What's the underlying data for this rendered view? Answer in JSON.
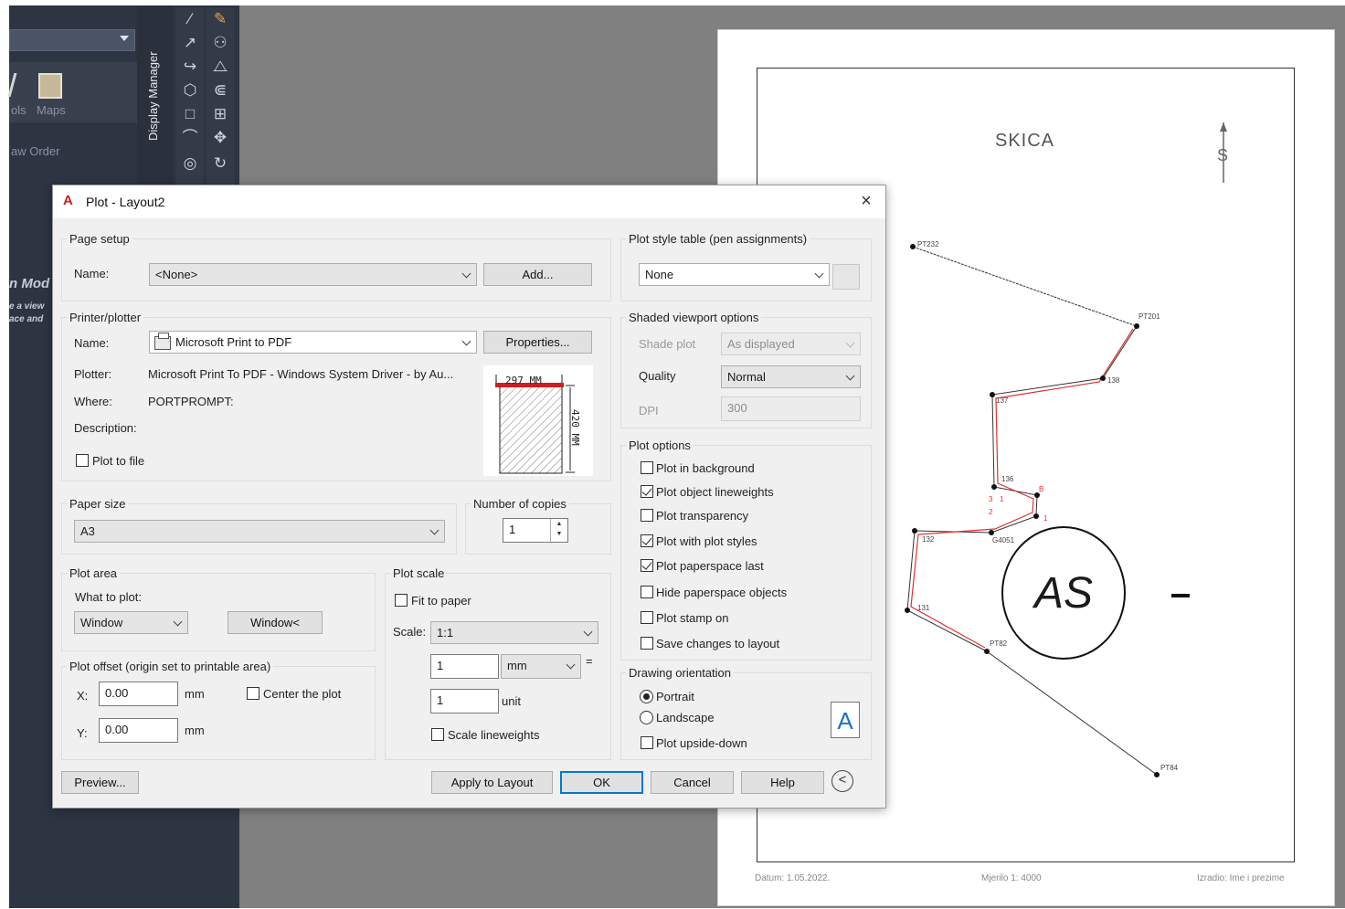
{
  "window": {
    "title": "Plot - Layout2",
    "close": "×"
  },
  "background": {
    "side_tools_label": "ols",
    "side_maps_label": "Maps",
    "side_draw_order": "aw Order",
    "display_manager": "Display Manager",
    "side_model": "n Mod",
    "side_view_1": "e a view",
    "side_view_2": "ace and"
  },
  "sheet": {
    "title": "SKICA",
    "north_symbol": "S",
    "footer_date": "Datum: 1.05.2022.",
    "footer_scale": "Mjerilo 1: 4000",
    "footer_author": "Izradio: Ime i prezime",
    "circle_text": "AS",
    "points": [
      "PT232",
      "PT201",
      "138",
      "137",
      "136",
      "B",
      "3",
      "1",
      "2",
      "132",
      "G4051",
      "131",
      "PT82",
      "PT84",
      "1"
    ]
  },
  "page_setup": {
    "label": "Page setup",
    "name_label": "Name:",
    "name_value": "<None>",
    "add_button": "Add..."
  },
  "printer": {
    "label": "Printer/plotter",
    "name_label": "Name:",
    "name_value": "Microsoft Print to PDF",
    "properties_button": "Properties...",
    "plotter_label": "Plotter:",
    "plotter_value": "Microsoft Print To PDF - Windows System Driver - by Au...",
    "where_label": "Where:",
    "where_value": "PORTPROMPT:",
    "description_label": "Description:",
    "plot_to_file": "Plot to file",
    "plot_to_file_checked": false,
    "preview_width": "297  MM",
    "preview_height": "420  MM"
  },
  "paper_size": {
    "label": "Paper size",
    "value": "A3"
  },
  "copies": {
    "label": "Number of copies",
    "value": "1"
  },
  "plot_area": {
    "label": "Plot area",
    "what_label": "What to plot:",
    "what_value": "Window",
    "window_button": "Window<"
  },
  "plot_offset": {
    "label": "Plot offset (origin set to printable area)",
    "x_label": "X:",
    "x_value": "0.00",
    "y_label": "Y:",
    "y_value": "0.00",
    "unit": "mm",
    "center": "Center the plot",
    "center_checked": false
  },
  "plot_scale": {
    "label": "Plot scale",
    "fit_to_paper": "Fit to paper",
    "fit_checked": false,
    "scale_label": "Scale:",
    "scale_value": "1:1",
    "value1": "1",
    "unit1": "mm",
    "equals": "=",
    "value2": "1",
    "unit2": "unit",
    "scale_lineweights": "Scale lineweights",
    "scale_lineweights_checked": false
  },
  "plot_style": {
    "label": "Plot style table (pen assignments)",
    "value": "None"
  },
  "shaded_viewport": {
    "label": "Shaded viewport options",
    "shade_label": "Shade plot",
    "shade_value": "As displayed",
    "quality_label": "Quality",
    "quality_value": "Normal",
    "dpi_label": "DPI",
    "dpi_value": "300"
  },
  "plot_options": {
    "label": "Plot options",
    "items": [
      {
        "label": "Plot in background",
        "checked": false
      },
      {
        "label": "Plot object lineweights",
        "checked": true
      },
      {
        "label": "Plot transparency",
        "checked": false
      },
      {
        "label": "Plot with plot styles",
        "checked": true
      },
      {
        "label": "Plot paperspace last",
        "checked": true
      },
      {
        "label": "Hide paperspace objects",
        "checked": false
      },
      {
        "label": "Plot stamp on",
        "checked": false
      },
      {
        "label": "Save changes to layout",
        "checked": false
      }
    ]
  },
  "orientation": {
    "label": "Drawing orientation",
    "portrait": "Portrait",
    "landscape": "Landscape",
    "selected": "Portrait",
    "upside_down": "Plot upside-down",
    "upside_down_checked": false,
    "icon_letter": "A"
  },
  "buttons": {
    "preview": "Preview...",
    "apply": "Apply to Layout",
    "ok": "OK",
    "cancel": "Cancel",
    "help": "Help",
    "collapse": "<"
  },
  "colors": {
    "accent": "#0078d7",
    "title_icon": "#c8201d",
    "preview_red": "#cc1f1f",
    "dark_panel": "#2d3543",
    "viewport_gray": "#808080"
  }
}
